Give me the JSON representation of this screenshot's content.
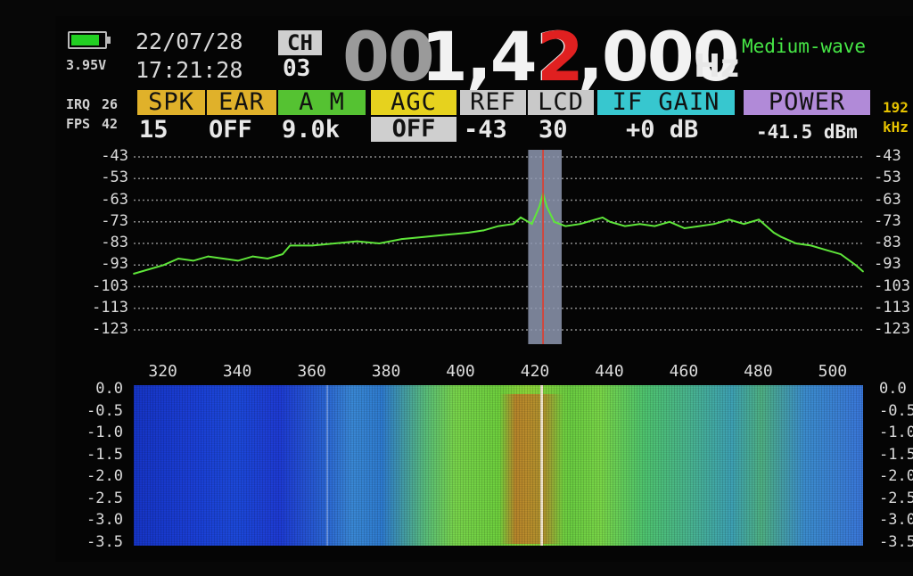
{
  "status": {
    "battery_voltage": "3.95V",
    "battery_level": 0.85,
    "irq_label": "IRQ",
    "irq_value": "26",
    "fps_label": "FPS",
    "fps_value": "42"
  },
  "datetime": {
    "date": "22/07/28",
    "time": "17:21:28"
  },
  "channel": {
    "label": "CH",
    "number": "03"
  },
  "frequency": {
    "leading_zeros": "00",
    "part1": "1,42",
    "highlight": "2",
    "part2": ",000",
    "unit": "Hz"
  },
  "band": "Medium-wave",
  "controls": [
    {
      "id": "spk",
      "label": "SPK",
      "value": "15",
      "color": "#e0b12a"
    },
    {
      "id": "ear",
      "label": "EAR",
      "value": "OFF",
      "color": "#e0b12a"
    },
    {
      "id": "mode",
      "label": "A M",
      "value": "9.0k",
      "color": "#55c232"
    },
    {
      "id": "agc",
      "label": "AGC",
      "value": "OFF",
      "color": "#e6d21e"
    },
    {
      "id": "ref",
      "label": "REF",
      "value": "-43",
      "color": "#c9c9c9"
    },
    {
      "id": "lcd",
      "label": "LCD",
      "value": "30",
      "color": "#c9c9c9"
    },
    {
      "id": "ifgain",
      "label": "IF GAIN",
      "value": "+0  dB",
      "color": "#37c7cf"
    },
    {
      "id": "power",
      "label": "POWER",
      "value": "-41.5 dBm",
      "color": "#b18ad8"
    }
  ],
  "sample_rate": {
    "value": "192",
    "unit": "kHz"
  },
  "colors": {
    "trace": "#5fe63a",
    "marker": "#e23b2b",
    "band_shade": "#8e98b0",
    "grid": "#8a8a8a"
  },
  "chart_data": {
    "type": "line",
    "xlim": [
      312,
      508
    ],
    "ylim": [
      -123,
      -43
    ],
    "y_ticks": [
      "-43",
      "-53",
      "-63",
      "-73",
      "-83",
      "-93",
      "-103",
      "-113",
      "-123"
    ],
    "x_ticks": [
      "320",
      "340",
      "360",
      "380",
      "400",
      "420",
      "440",
      "460",
      "480",
      "500"
    ],
    "selected_freq": 422,
    "bandwidth": [
      418,
      427
    ],
    "series": [
      {
        "x": [
          312,
          320,
          324,
          328,
          332,
          336,
          340,
          344,
          348,
          352,
          354,
          360,
          366,
          372,
          378,
          384,
          390,
          396,
          402,
          406,
          410,
          414,
          416,
          419,
          421,
          422,
          423,
          425,
          428,
          432,
          436,
          438,
          440,
          444,
          448,
          452,
          456,
          460,
          464,
          468,
          472,
          476,
          480,
          484,
          486,
          490,
          494,
          498,
          502,
          506,
          508
        ],
        "y": [
          -97,
          -93,
          -90,
          -91,
          -89,
          -90,
          -91,
          -89,
          -90,
          -88,
          -84,
          -84,
          -83,
          -82,
          -83,
          -81,
          -80,
          -79,
          -78,
          -77,
          -75,
          -74,
          -71,
          -74,
          -66,
          -60,
          -66,
          -73,
          -75,
          -74,
          -72,
          -71,
          -73,
          -75,
          -74,
          -75,
          -73,
          -76,
          -75,
          -74,
          -72,
          -74,
          -72,
          -78,
          -80,
          -83,
          -84,
          -86,
          -88,
          -93,
          -96
        ]
      }
    ]
  },
  "waterfall": {
    "y_ticks": [
      "0.0",
      "-0.5",
      "-1.0",
      "-1.5",
      "-2.0",
      "-2.5",
      "-3.0",
      "-3.5"
    ]
  }
}
